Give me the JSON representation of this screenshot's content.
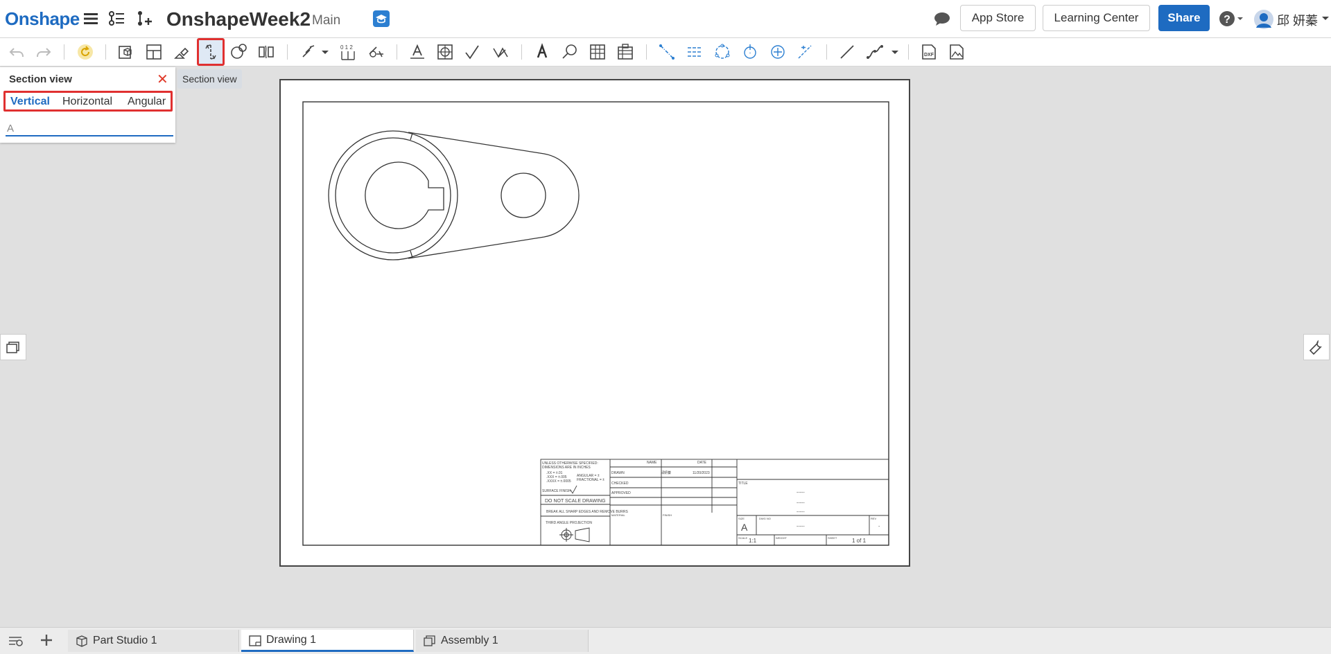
{
  "header": {
    "logo": "Onshape",
    "doc_title": "OnshapeWeek2",
    "branch": "Main",
    "app_store": "App Store",
    "learning_center": "Learning Center",
    "share": "Share",
    "help": "?",
    "user_name": "邱 妍蓁"
  },
  "panel": {
    "title": "Section view",
    "tabs": [
      "Vertical",
      "Horizontal",
      "Angular"
    ],
    "selected_tab": "Vertical",
    "input_value": "A"
  },
  "tooltip": "Section view",
  "title_block": {
    "notes": [
      "UNLESS OTHERWISE SPECIFIED:",
      "DIMENSIONS ARE IN INCHES",
      ".XX = ±.01",
      ".XXX = ±.005",
      ".XXXX = ±.0005",
      "ANGULAR = ±",
      "FRACTIONAL = ±",
      "SURFACE FINISH"
    ],
    "do_not_scale": "DO NOT SCALE DRAWING",
    "break_edges": "BREAK ALL SHARP EDGES AND REMOVE BURRS",
    "projection": "THIRD ANGLE PROJECTION",
    "headers": {
      "name": "NAME",
      "date": "DATE",
      "title": "TITLE",
      "size": "SIZE",
      "dwg_no": "DWG NO",
      "rev": "REV",
      "scale": "SCALE",
      "weight": "WEIGHT",
      "sheet": "SHEET",
      "material": "MATERIAL",
      "finish": "FINISH"
    },
    "rows": [
      "DRAWN",
      "CHECKED",
      "APPROVED"
    ],
    "drawn_name": "邱妍蓁",
    "drawn_date": "11/20/2023",
    "size_value": "A",
    "scale_value": "1:1",
    "sheet_value": "1 of 1",
    "placeholder": "-----",
    "rev_value": "-"
  },
  "bottom_tabs": [
    {
      "label": "Part Studio 1"
    },
    {
      "label": "Drawing 1"
    },
    {
      "label": "Assembly 1"
    }
  ],
  "colors": {
    "accent": "#1e6bc1",
    "highlight": "#e03030",
    "close": "#e03a2a"
  }
}
